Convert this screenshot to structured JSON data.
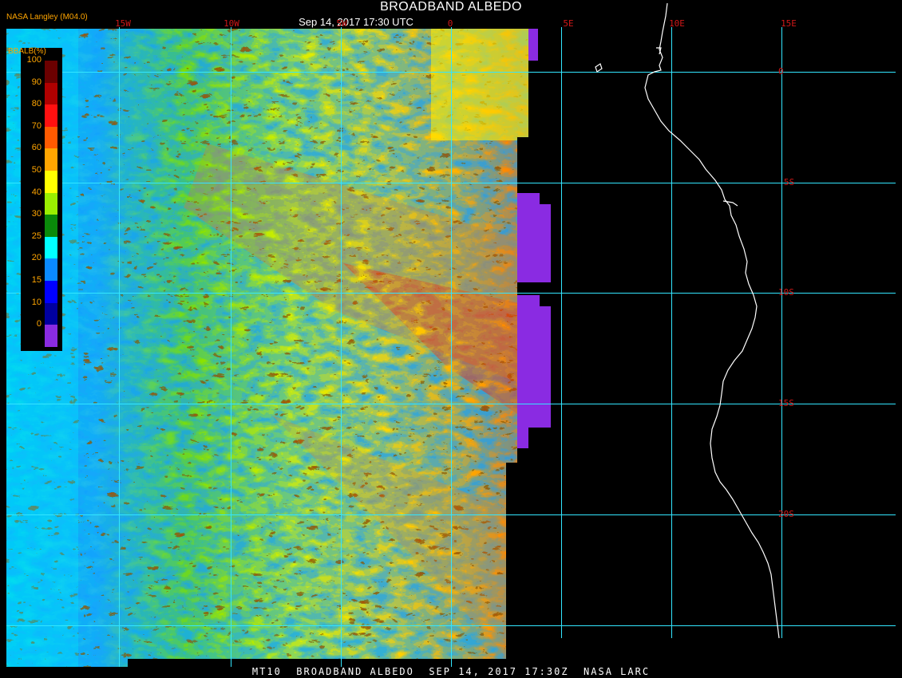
{
  "header": {
    "title": "BROADBAND ALBEDO",
    "subtitle": "Sep 14, 2017 17:30 UTC",
    "credit": "NASA Langley (M04.0)"
  },
  "footer": {
    "text": "MT10  BROADBAND ALBEDO  SEP 14, 2017 17:30Z  NASA LARC"
  },
  "longitude_labels": [
    "15W",
    "10W",
    "5W",
    "0",
    "5E",
    "10E",
    "15E"
  ],
  "latitude_labels": [
    "0",
    "5S",
    "10S",
    "15S",
    "20S"
  ],
  "legend": {
    "title": "BBALB(%)",
    "ticks": [
      "100",
      "90",
      "80",
      "70",
      "60",
      "50",
      "40",
      "30",
      "25",
      "20",
      "15",
      "10",
      "0"
    ],
    "colors": [
      "#6b0000",
      "#b00000",
      "#ff1010",
      "#ff5a00",
      "#ffa500",
      "#ffff00",
      "#9aee00",
      "#0a8a0a",
      "#00ffff",
      "#0a8aff",
      "#0000ff",
      "#0000a0",
      "#8a2be2"
    ]
  },
  "colors": {
    "grid": "#33e6ff",
    "coastline": "#ffffff",
    "label": "#d01818",
    "legend_text": "#ffa500"
  }
}
